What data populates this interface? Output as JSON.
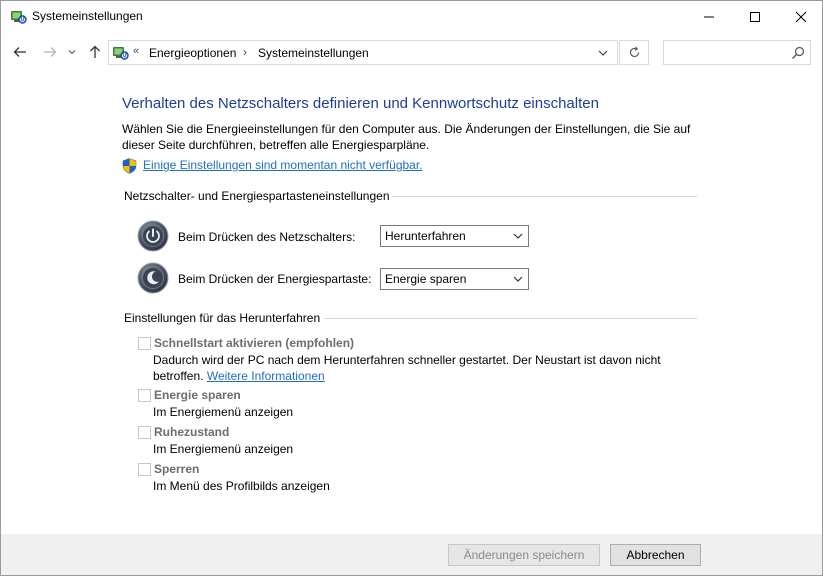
{
  "window": {
    "title": "Systemeinstellungen"
  },
  "address": {
    "chevron": "«",
    "crumb1": "Energieoptionen",
    "separator": "›",
    "crumb2": "Systemeinstellungen"
  },
  "search": {
    "placeholder": "",
    "value": ""
  },
  "main": {
    "heading": "Verhalten des Netzschalters definieren und Kennwortschutz einschalten",
    "description": "Wählen Sie die Energieeinstellungen für den Computer aus. Die Änderungen der Einstellungen, die Sie auf dieser Seite durchführen, betreffen alle Energiesparpläne.",
    "unavailable_link": "Einige Einstellungen sind momentan nicht verfügbar."
  },
  "power_section": {
    "title": "Netzschalter- und Energiespartasteneinstellungen",
    "power_button_label": "Beim Drücken des Netzschalters:",
    "power_button_value": "Herunterfahren",
    "sleep_button_label": "Beim Drücken der Energiespartaste:",
    "sleep_button_value": "Energie sparen"
  },
  "shutdown_section": {
    "title": "Einstellungen für das Herunterfahren",
    "items": [
      {
        "label": "Schnellstart aktivieren (empfohlen)",
        "description": "Dadurch wird der PC nach dem Herunterfahren schneller gestartet. Der Neustart ist davon nicht betroffen.",
        "link": "Weitere Informationen",
        "checked": false
      },
      {
        "label": "Energie sparen",
        "description": "Im Energiemenü anzeigen",
        "checked": false
      },
      {
        "label": "Ruhezustand",
        "description": "Im Energiemenü anzeigen",
        "checked": false
      },
      {
        "label": "Sperren",
        "description": "Im Menü des Profilbilds anzeigen",
        "checked": false
      }
    ]
  },
  "footer": {
    "save_label": "Änderungen speichern",
    "cancel_label": "Abbrechen"
  },
  "colors": {
    "heading": "#1c3f94",
    "link": "#1f6fc5",
    "footer_bg": "#f0f0f0",
    "disabled_text": "#6d6d6d"
  },
  "icons": {
    "app": "power-options-icon",
    "shield": "uac-shield-icon",
    "power_button": "power-button-icon",
    "sleep_button": "sleep-button-icon"
  }
}
